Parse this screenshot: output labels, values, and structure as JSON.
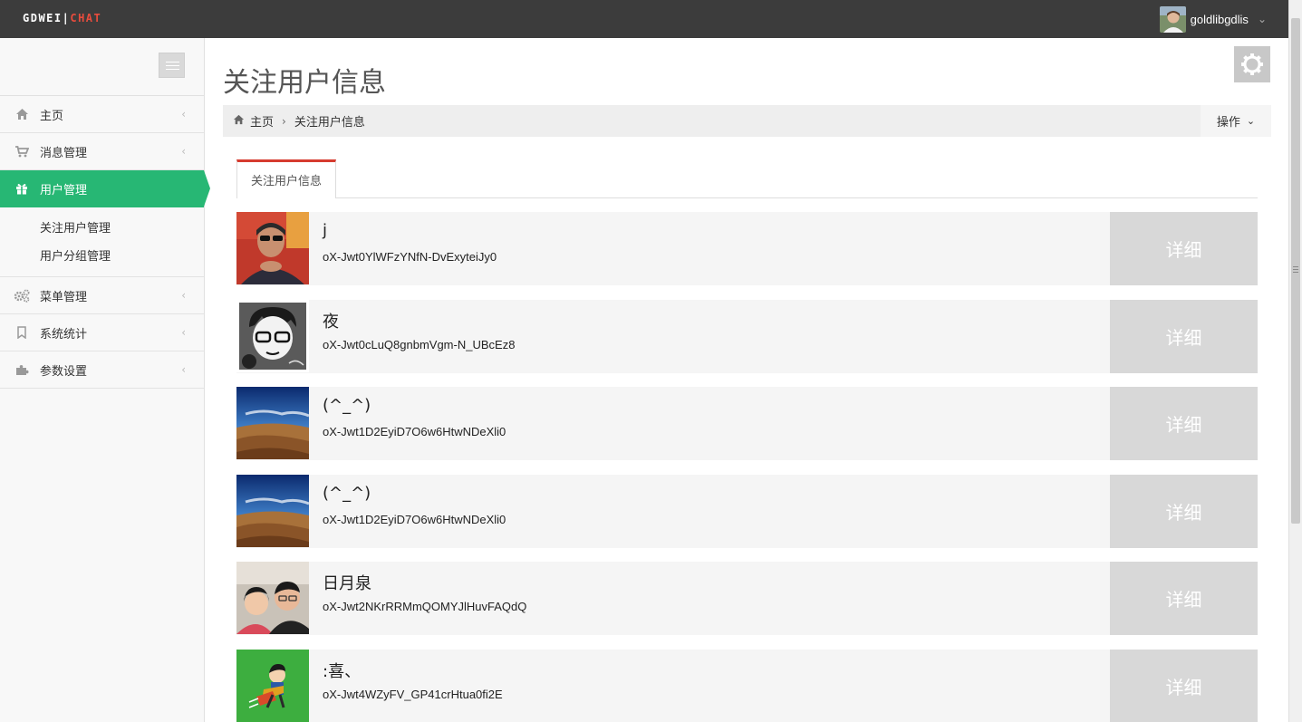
{
  "brand": {
    "part1": "GDWEI",
    "sep": "|",
    "part2": "CHAT"
  },
  "user_menu": {
    "username": "goldlibgdlis"
  },
  "sidebar": {
    "items": [
      {
        "label": "主页",
        "icon": "home-icon"
      },
      {
        "label": "消息管理",
        "icon": "cart-icon"
      },
      {
        "label": "用户管理",
        "icon": "gift-icon",
        "active": true
      },
      {
        "label": "菜单管理",
        "icon": "cogs-icon"
      },
      {
        "label": "系统统计",
        "icon": "bookmark-icon"
      },
      {
        "label": "参数设置",
        "icon": "puzzle-icon"
      }
    ],
    "submenu": [
      {
        "label": "关注用户管理"
      },
      {
        "label": "用户分组管理"
      }
    ]
  },
  "page": {
    "title": "关注用户信息",
    "breadcrumb": {
      "home": "主页",
      "current": "关注用户信息"
    },
    "ops_label": "操作",
    "tab_label": "关注用户信息"
  },
  "users": [
    {
      "nickname": "j",
      "openid": "oX-Jwt0YlWFzYNfN-DvExyteiJy0",
      "detail_label": "详细"
    },
    {
      "nickname": "夜",
      "openid": "oX-Jwt0cLuQ8gnbmVgm-N_UBcEz8",
      "detail_label": "详细"
    },
    {
      "nickname": "(^_^)",
      "openid": "oX-Jwt1D2EyiD7O6w6HtwNDeXli0",
      "detail_label": "详细"
    },
    {
      "nickname": "(^_^)",
      "openid": "oX-Jwt1D2EyiD7O6w6HtwNDeXli0",
      "detail_label": "详细"
    },
    {
      "nickname": "日月泉",
      "openid": "oX-Jwt2NKrRRMmQOMYJlHuvFAQdQ",
      "detail_label": "详细"
    },
    {
      "nickname": ":喜、",
      "openid": "oX-Jwt4WZyFV_GP41crHtua0fi2E",
      "detail_label": "详细"
    }
  ],
  "colors": {
    "navbar": "#3c3c3c",
    "accent_green": "#27b774",
    "brand_red": "#e84c3d",
    "tab_red": "#d63b2f",
    "detail_button": "#d8d8d8"
  }
}
